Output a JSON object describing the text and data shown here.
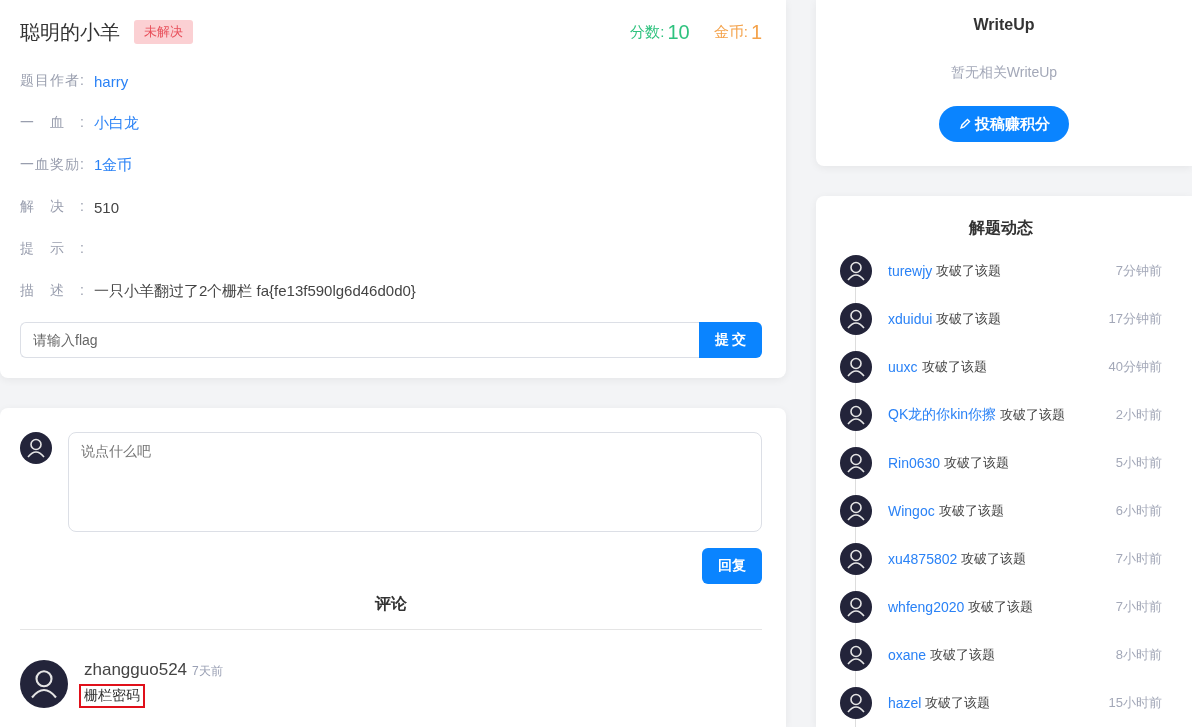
{
  "challenge": {
    "title": "聪明的小羊",
    "status": "未解决",
    "score_label": "分数:",
    "score": "10",
    "coin_label": "金币:",
    "coin": "1",
    "fields": [
      {
        "label": "题目作者:",
        "value": "harry",
        "kind": "link"
      },
      {
        "label": "一血:",
        "value": "小白龙",
        "kind": "link"
      },
      {
        "label": "一血奖励:",
        "value": "1金币",
        "kind": "link"
      },
      {
        "label": "解决:",
        "value": "510",
        "kind": "text"
      },
      {
        "label": "提示:",
        "kind": "text"
      },
      {
        "label": "描述:",
        "value": "一只小羊翻过了2个栅栏 fa{fe13f590lg6d46d0d0}",
        "kind": "text"
      }
    ],
    "flag_input": {
      "placeholder": "请输入flag"
    },
    "submit": "提 交"
  },
  "comment_box": {
    "placeholder": "说点什么吧",
    "reply": "回复"
  },
  "comments": {
    "title": "评论",
    "items": [
      {
        "user": "zhangguo524",
        "time": "7天前",
        "text": "栅栏密码",
        "highlighted": true
      }
    ]
  },
  "writeup": {
    "title": "WriteUp",
    "empty": "暂无相关WriteUp",
    "button": "投稿赚积分"
  },
  "activity": {
    "title": "解题动态",
    "items": [
      {
        "user": "turewjy",
        "action": "攻破了该题",
        "time": "7分钟前"
      },
      {
        "user": "xduidui",
        "action": "攻破了该题",
        "time": "17分钟前"
      },
      {
        "user": "uuxc",
        "action": "攻破了该题",
        "time": "40分钟前"
      },
      {
        "user": "QK龙的你kin你擦",
        "action": "攻破了该题",
        "time": "2小时前"
      },
      {
        "user": "Rin0630",
        "action": "攻破了该题",
        "time": "5小时前"
      },
      {
        "user": "Wingoc",
        "action": "攻破了该题",
        "time": "6小时前"
      },
      {
        "user": "xu4875802",
        "action": "攻破了该题",
        "time": "7小时前"
      },
      {
        "user": "whfeng2020",
        "action": "攻破了该题",
        "time": "7小时前"
      },
      {
        "user": "oxane",
        "action": "攻破了该题",
        "time": "8小时前"
      },
      {
        "user": "hazel",
        "action": "攻破了该题",
        "time": "15小时前"
      }
    ]
  }
}
